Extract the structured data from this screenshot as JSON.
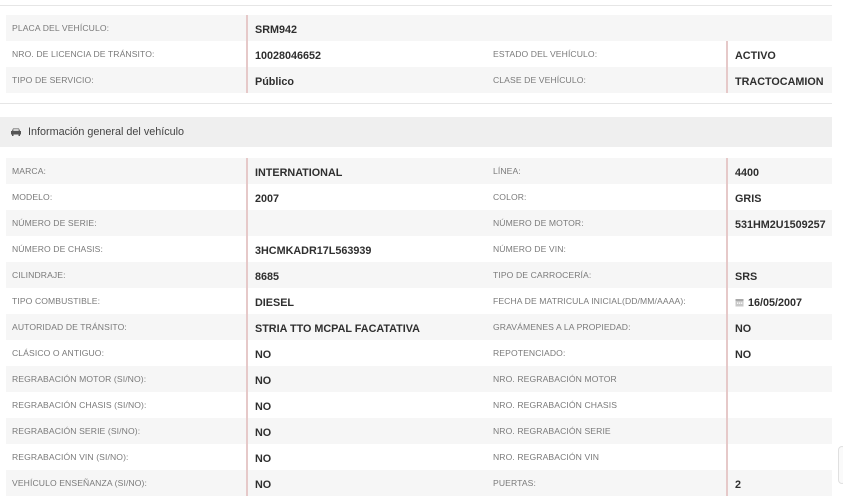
{
  "registration": {
    "rows": [
      {
        "label1": "PLACA DEL VEHÍCULO:",
        "value1": "SRM942",
        "label2": "",
        "value2": ""
      },
      {
        "label1": "NRO. DE LICENCIA DE TRÁNSITO:",
        "value1": "10028046652",
        "label2": "ESTADO DEL VEHÍCULO:",
        "value2": "ACTIVO"
      },
      {
        "label1": "TIPO DE SERVICIO:",
        "value1": "Público",
        "label2": "CLASE DE VEHÍCULO:",
        "value2": "TRACTOCAMION"
      }
    ]
  },
  "section": {
    "icon": "car-icon",
    "title": "Información general del vehículo"
  },
  "general": {
    "rows": [
      {
        "label1": "MARCA:",
        "value1": "INTERNATIONAL",
        "label2": "LÍNEA:",
        "value2": "4400"
      },
      {
        "label1": "MODELO:",
        "value1": "2007",
        "label2": "COLOR:",
        "value2": "GRIS"
      },
      {
        "label1": "NÚMERO DE SERIE:",
        "value1": "",
        "label2": "NÚMERO DE MOTOR:",
        "value2": "531HM2U1509257"
      },
      {
        "label1": "NÚMERO DE CHASIS:",
        "value1": "3HCMKADR17L563939",
        "label2": "NÚMERO DE VIN:",
        "value2": ""
      },
      {
        "label1": "CILINDRAJE:",
        "value1": "8685",
        "label2": "TIPO DE CARROCERÍA:",
        "value2": "SRS"
      },
      {
        "label1": "TIPO COMBUSTIBLE:",
        "value1": "DIESEL",
        "label2": "FECHA DE MATRICULA INICIAL(DD/MM/AAAA):",
        "value2": "16/05/2007",
        "value2_icon": "calendar-icon"
      },
      {
        "label1": "AUTORIDAD DE TRÁNSITO:",
        "value1": "STRIA TTO MCPAL FACATATIVA",
        "label2": "GRAVÁMENES A LA PROPIEDAD:",
        "value2": "NO"
      },
      {
        "label1": "CLÁSICO O ANTIGUO:",
        "value1": "NO",
        "label2": "REPOTENCIADO:",
        "value2": "NO"
      },
      {
        "label1": "REGRABACIÓN MOTOR (SI/NO):",
        "value1": "NO",
        "label2": "NRO. REGRABACIÓN MOTOR",
        "value2": ""
      },
      {
        "label1": "REGRABACIÓN CHASIS (SI/NO):",
        "value1": "NO",
        "label2": "NRO. REGRABACIÓN CHASIS",
        "value2": ""
      },
      {
        "label1": "REGRABACIÓN SERIE (SI/NO):",
        "value1": "NO",
        "label2": "NRO. REGRABACIÓN SERIE",
        "value2": ""
      },
      {
        "label1": "REGRABACIÓN VIN (SI/NO):",
        "value1": "NO",
        "label2": "NRO. REGRABACIÓN VIN",
        "value2": ""
      },
      {
        "label1": "VEHÍCULO ENSEÑANZA (SI/NO):",
        "value1": "NO",
        "label2": "PUERTAS:",
        "value2": "2"
      }
    ]
  }
}
